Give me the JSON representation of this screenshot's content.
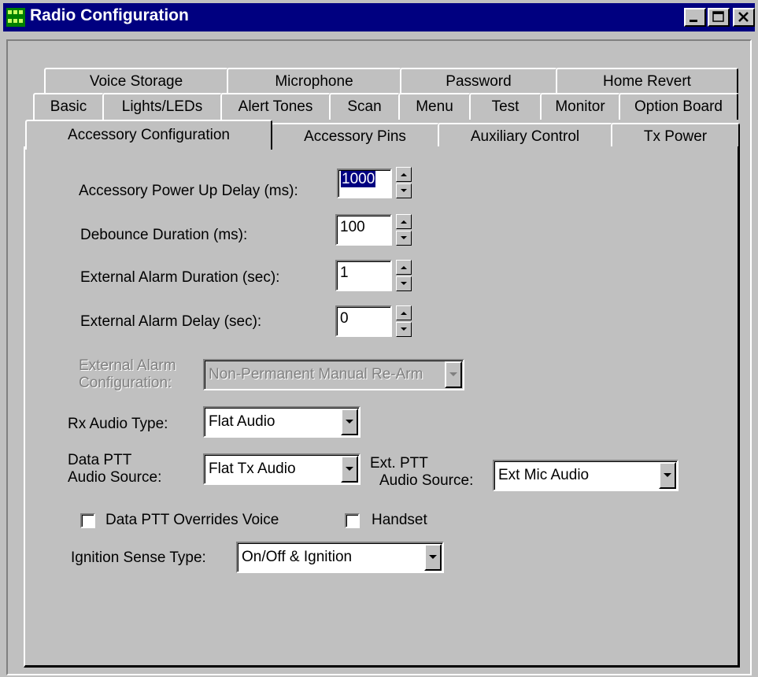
{
  "window": {
    "title": "Radio Configuration",
    "icon": "radio-config-app-icon",
    "controls": [
      "minimize-icon",
      "maximize-icon",
      "close-icon"
    ]
  },
  "tabs": {
    "row1": [
      "Voice Storage",
      "Microphone",
      "Password",
      "Home Revert"
    ],
    "row2": [
      "Basic",
      "Lights/LEDs",
      "Alert Tones",
      "Scan",
      "Menu",
      "Test",
      "Monitor",
      "Option Board"
    ],
    "row3": [
      "Accessory Configuration",
      "Accessory Pins",
      "Auxiliary Control",
      "Tx Power"
    ],
    "active": "Accessory Configuration"
  },
  "form": {
    "power_up_delay": {
      "label": "Accessory Power Up Delay (ms):",
      "value": "1000"
    },
    "debounce": {
      "label": "Debounce Duration (ms):",
      "value": "100"
    },
    "alarm_duration": {
      "label": "External Alarm Duration (sec):",
      "value": "1"
    },
    "alarm_delay": {
      "label": "External Alarm Delay (sec):",
      "value": "0"
    },
    "alarm_config": {
      "label_line1": "External Alarm",
      "label_line2": "Configuration:",
      "value": "Non-Permanent Manual Re-Arm",
      "enabled": false
    },
    "rx_audio": {
      "label": "Rx Audio Type:",
      "value": "Flat Audio"
    },
    "data_ptt": {
      "label_line1": "Data PTT",
      "label_line2": "Audio Source:",
      "value": "Flat Tx Audio"
    },
    "ext_ptt": {
      "label_line1": "Ext. PTT",
      "label_line2": "Audio Source:",
      "value": "Ext Mic Audio"
    },
    "data_ptt_overrides": {
      "label": "Data PTT Overrides Voice",
      "checked": false
    },
    "handset": {
      "label": "Handset",
      "checked": false
    },
    "ignition": {
      "label": "Ignition Sense Type:",
      "value": "On/Off & Ignition"
    }
  },
  "colors": {
    "titlebar": "#000080",
    "face": "#c0c0c0",
    "selection": "#000080",
    "disabled_text": "#808080"
  }
}
